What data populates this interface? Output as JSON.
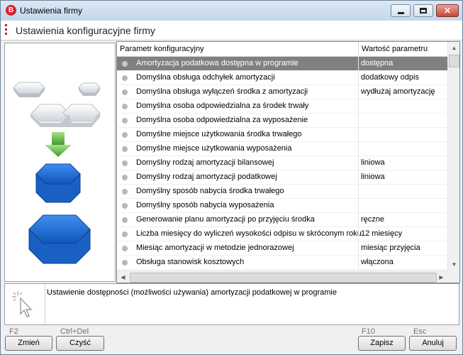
{
  "window": {
    "title": "Ustawienia firmy",
    "app_icon_letter": "B",
    "close_glyph": "✕"
  },
  "header": {
    "title": "Ustawienia konfiguracyjne firmy"
  },
  "grid": {
    "columns": [
      "Parametr konfiguracyjny",
      "Wartość parametru"
    ],
    "selected_index": 0,
    "rows": [
      {
        "name": "Amortyzacja podatkowa dostępna w programie",
        "value": "dostępna"
      },
      {
        "name": "Domyślna obsługa odchyłek amortyzacji",
        "value": "dodatkowy odpis"
      },
      {
        "name": "Domyślna obsługa wyłączeń środka z amortyzacji",
        "value": "wydłużaj amortyzację"
      },
      {
        "name": "Domyślna osoba odpowiedzialna za środek trwały",
        "value": ""
      },
      {
        "name": "Domyślna osoba odpowiedzialna za wyposażenie",
        "value": ""
      },
      {
        "name": "Domyślne miejsce użytkowania środka trwałego",
        "value": ""
      },
      {
        "name": "Domyślne miejsce użytkowania wyposażenia",
        "value": ""
      },
      {
        "name": "Domyślny rodzaj amortyzacji bilansowej",
        "value": "liniowa"
      },
      {
        "name": "Domyślny rodzaj amortyzacji podatkowej",
        "value": "liniowa"
      },
      {
        "name": "Domyślny sposób nabycia środka trwałego",
        "value": ""
      },
      {
        "name": "Domyślny sposób nabycia wyposażenia",
        "value": ""
      },
      {
        "name": "Generowanie planu amortyzacji po przyjęciu środka",
        "value": "ręczne"
      },
      {
        "name": "Liczba miesięcy do wyliczeń wysokości odpisu w skróconym roku",
        "value": "12 miesięcy"
      },
      {
        "name": "Miesiąc amortyzacji w metodzie jednorazowej",
        "value": "miesiąc przyjęcia"
      },
      {
        "name": "Obsługa stanowisk kosztowych",
        "value": "włączona"
      }
    ]
  },
  "description": {
    "text": "Ustawienie dostępności (możliwości używania) amortyzacji podatkowej w programie"
  },
  "footer": {
    "change": {
      "key": "F2",
      "label": "Zmień"
    },
    "clear": {
      "key": "Ctrl+Del",
      "label": "Czyść"
    },
    "save": {
      "key": "F10",
      "label": "Zapisz"
    },
    "cancel": {
      "key": "Esc",
      "label": "Anuluj"
    }
  },
  "colors": {
    "selection": "#808080",
    "accent": "#c5212a",
    "hex_blue": "#1f6fd6",
    "arrow_green": "#6cc04a"
  },
  "icons": [
    "app-logo-icon",
    "minimize-icon",
    "maximize-icon",
    "close-icon",
    "hexagon-illustration",
    "cursor-hint-icon",
    "scroll-up-icon",
    "scroll-down-icon",
    "scroll-left-icon",
    "scroll-right-icon"
  ]
}
